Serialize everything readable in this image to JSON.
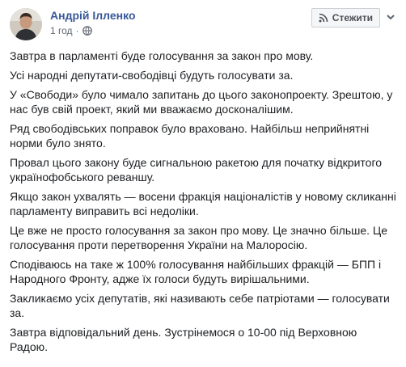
{
  "post": {
    "author": "Андрій Ілленко",
    "timestamp": "1 год",
    "separator": "·",
    "privacy_icon": "globe-icon",
    "follow_label": "Стежити",
    "follow_icon": "rss-icon",
    "options_icon": "chevron-down-icon",
    "colors": {
      "author": "#385898",
      "text": "#1c1e21",
      "meta": "#616770",
      "button_bg": "#f5f6f7",
      "button_border": "#ccd0d5"
    },
    "paragraphs": [
      "Завтра в парламенті буде голосування за закон про мову.",
      "Усі народні депутати-свободівці будуть голосувати за.",
      "У «Свободи» було чимало запитань до цього законопроекту. Зрештою, у нас був свій проект, який ми вважаємо досконалішим.",
      "Ряд свободівських поправок було враховано. Найбільш неприйнятні норми було знято.",
      "Провал цього закону буде сигнальною ракетою для початку відкритого українофобського реваншу.",
      "Якщо закон ухвалять — восени фракція націоналістів у новому скликанні парламенту виправить всі недоліки.",
      "Це вже не просто голосування за закон про мову. Це значно більше. Це голосування проти перетворення України на Малоросію.",
      "Сподіваюсь на таке ж 100% голосування найбільших фракцій — БПП і Народного Фронту, адже їх голоси будуть вирішальними.",
      "Закликаємо усіх депутатів, які називають себе патріотами — голосувати за.",
      "Завтра відповідальний день. Зустрінемося о 10-00 під Верховною Радою."
    ]
  }
}
